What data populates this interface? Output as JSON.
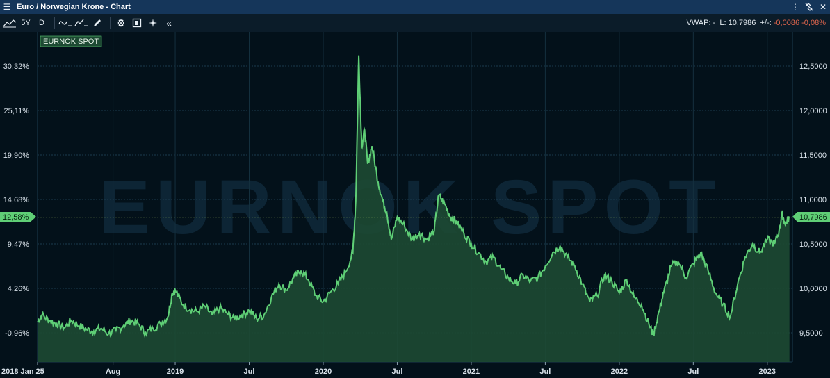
{
  "window": {
    "title": "Euro / Norwegian Krone - Chart"
  },
  "toolbar": {
    "period_label": "5Y",
    "interval_label": "D"
  },
  "readout": {
    "vwap_label": "VWAP: -",
    "last_label": "L: 10,7986",
    "change_label": "+/-:",
    "change_value": "-0,0086",
    "change_pct": "-0,08%"
  },
  "colors": {
    "series_line": "#5fcf76",
    "series_fill": "#1d4a33",
    "title_bar": "#15365a",
    "background": "#03111a",
    "negative": "#e0664d"
  },
  "chart_data": {
    "type": "area",
    "legend_label": "EURNOK SPOT",
    "watermark": "EURNOK SPOT",
    "current_value_label": "10,7986",
    "current_pct_label": "12,58%",
    "left_axis_ticks": [
      "30,32%",
      "25,11%",
      "19,90%",
      "14,68%",
      "9,47%",
      "4,26%",
      "-0,96%"
    ],
    "right_axis_ticks": [
      "12,5000",
      "12,0000",
      "11,5000",
      "11,0000",
      "10,5000",
      "10,0000",
      "9,5000"
    ],
    "x_ticks": [
      "2018 Jan 25",
      "Aug",
      "2019",
      "Jul",
      "2020",
      "Jul",
      "2021",
      "Jul",
      "2022",
      "Jul",
      "2023"
    ],
    "ylim": [
      9.2,
      12.8
    ],
    "series": [
      {
        "values": [
          [
            2018.07,
            9.62
          ],
          [
            2018.1,
            9.7
          ],
          [
            2018.15,
            9.64
          ],
          [
            2018.2,
            9.6
          ],
          [
            2018.25,
            9.56
          ],
          [
            2018.3,
            9.64
          ],
          [
            2018.35,
            9.58
          ],
          [
            2018.4,
            9.54
          ],
          [
            2018.45,
            9.52
          ],
          [
            2018.5,
            9.55
          ],
          [
            2018.55,
            9.49
          ],
          [
            2018.6,
            9.53
          ],
          [
            2018.65,
            9.58
          ],
          [
            2018.7,
            9.64
          ],
          [
            2018.75,
            9.6
          ],
          [
            2018.8,
            9.5
          ],
          [
            2018.85,
            9.55
          ],
          [
            2018.9,
            9.6
          ],
          [
            2018.95,
            9.68
          ],
          [
            2018.98,
            9.95
          ],
          [
            2019.0,
            9.98
          ],
          [
            2019.05,
            9.82
          ],
          [
            2019.1,
            9.76
          ],
          [
            2019.15,
            9.74
          ],
          [
            2019.2,
            9.8
          ],
          [
            2019.25,
            9.7
          ],
          [
            2019.3,
            9.78
          ],
          [
            2019.35,
            9.72
          ],
          [
            2019.4,
            9.66
          ],
          [
            2019.45,
            9.7
          ],
          [
            2019.5,
            9.75
          ],
          [
            2019.55,
            9.66
          ],
          [
            2019.6,
            9.7
          ],
          [
            2019.65,
            9.9
          ],
          [
            2019.7,
            10.05
          ],
          [
            2019.75,
            9.98
          ],
          [
            2019.8,
            10.12
          ],
          [
            2019.85,
            10.2
          ],
          [
            2019.9,
            10.1
          ],
          [
            2019.95,
            9.92
          ],
          [
            2020.0,
            9.85
          ],
          [
            2020.05,
            9.96
          ],
          [
            2020.1,
            10.05
          ],
          [
            2020.15,
            10.18
          ],
          [
            2020.2,
            10.4
          ],
          [
            2020.22,
            10.98
          ],
          [
            2020.24,
            12.62
          ],
          [
            2020.26,
            11.6
          ],
          [
            2020.28,
            11.78
          ],
          [
            2020.3,
            11.4
          ],
          [
            2020.33,
            11.6
          ],
          [
            2020.37,
            11.2
          ],
          [
            2020.4,
            11.0
          ],
          [
            2020.43,
            10.85
          ],
          [
            2020.46,
            10.55
          ],
          [
            2020.5,
            10.8
          ],
          [
            2020.55,
            10.7
          ],
          [
            2020.6,
            10.55
          ],
          [
            2020.65,
            10.62
          ],
          [
            2020.7,
            10.55
          ],
          [
            2020.75,
            10.65
          ],
          [
            2020.78,
            11.05
          ],
          [
            2020.82,
            10.95
          ],
          [
            2020.86,
            10.8
          ],
          [
            2020.9,
            10.75
          ],
          [
            2020.95,
            10.62
          ],
          [
            2021.0,
            10.5
          ],
          [
            2021.05,
            10.4
          ],
          [
            2021.1,
            10.3
          ],
          [
            2021.15,
            10.35
          ],
          [
            2021.2,
            10.22
          ],
          [
            2021.25,
            10.12
          ],
          [
            2021.3,
            10.05
          ],
          [
            2021.35,
            10.15
          ],
          [
            2021.4,
            10.08
          ],
          [
            2021.45,
            10.12
          ],
          [
            2021.5,
            10.25
          ],
          [
            2021.55,
            10.4
          ],
          [
            2021.6,
            10.48
          ],
          [
            2021.65,
            10.35
          ],
          [
            2021.7,
            10.25
          ],
          [
            2021.75,
            10.05
          ],
          [
            2021.8,
            9.85
          ],
          [
            2021.85,
            9.92
          ],
          [
            2021.9,
            10.15
          ],
          [
            2021.95,
            10.08
          ],
          [
            2022.0,
            9.95
          ],
          [
            2022.05,
            10.1
          ],
          [
            2022.1,
            9.9
          ],
          [
            2022.15,
            9.82
          ],
          [
            2022.2,
            9.6
          ],
          [
            2022.23,
            9.48
          ],
          [
            2022.27,
            9.75
          ],
          [
            2022.3,
            9.95
          ],
          [
            2022.35,
            10.25
          ],
          [
            2022.4,
            10.3
          ],
          [
            2022.45,
            10.12
          ],
          [
            2022.5,
            10.28
          ],
          [
            2022.55,
            10.4
          ],
          [
            2022.6,
            10.2
          ],
          [
            2022.65,
            9.95
          ],
          [
            2022.7,
            9.82
          ],
          [
            2022.75,
            9.68
          ],
          [
            2022.8,
            10.05
          ],
          [
            2022.85,
            10.35
          ],
          [
            2022.9,
            10.5
          ],
          [
            2022.95,
            10.4
          ],
          [
            2023.0,
            10.55
          ],
          [
            2023.05,
            10.5
          ],
          [
            2023.08,
            10.65
          ],
          [
            2023.1,
            10.85
          ],
          [
            2023.12,
            10.72
          ],
          [
            2023.15,
            10.8
          ]
        ]
      }
    ]
  }
}
